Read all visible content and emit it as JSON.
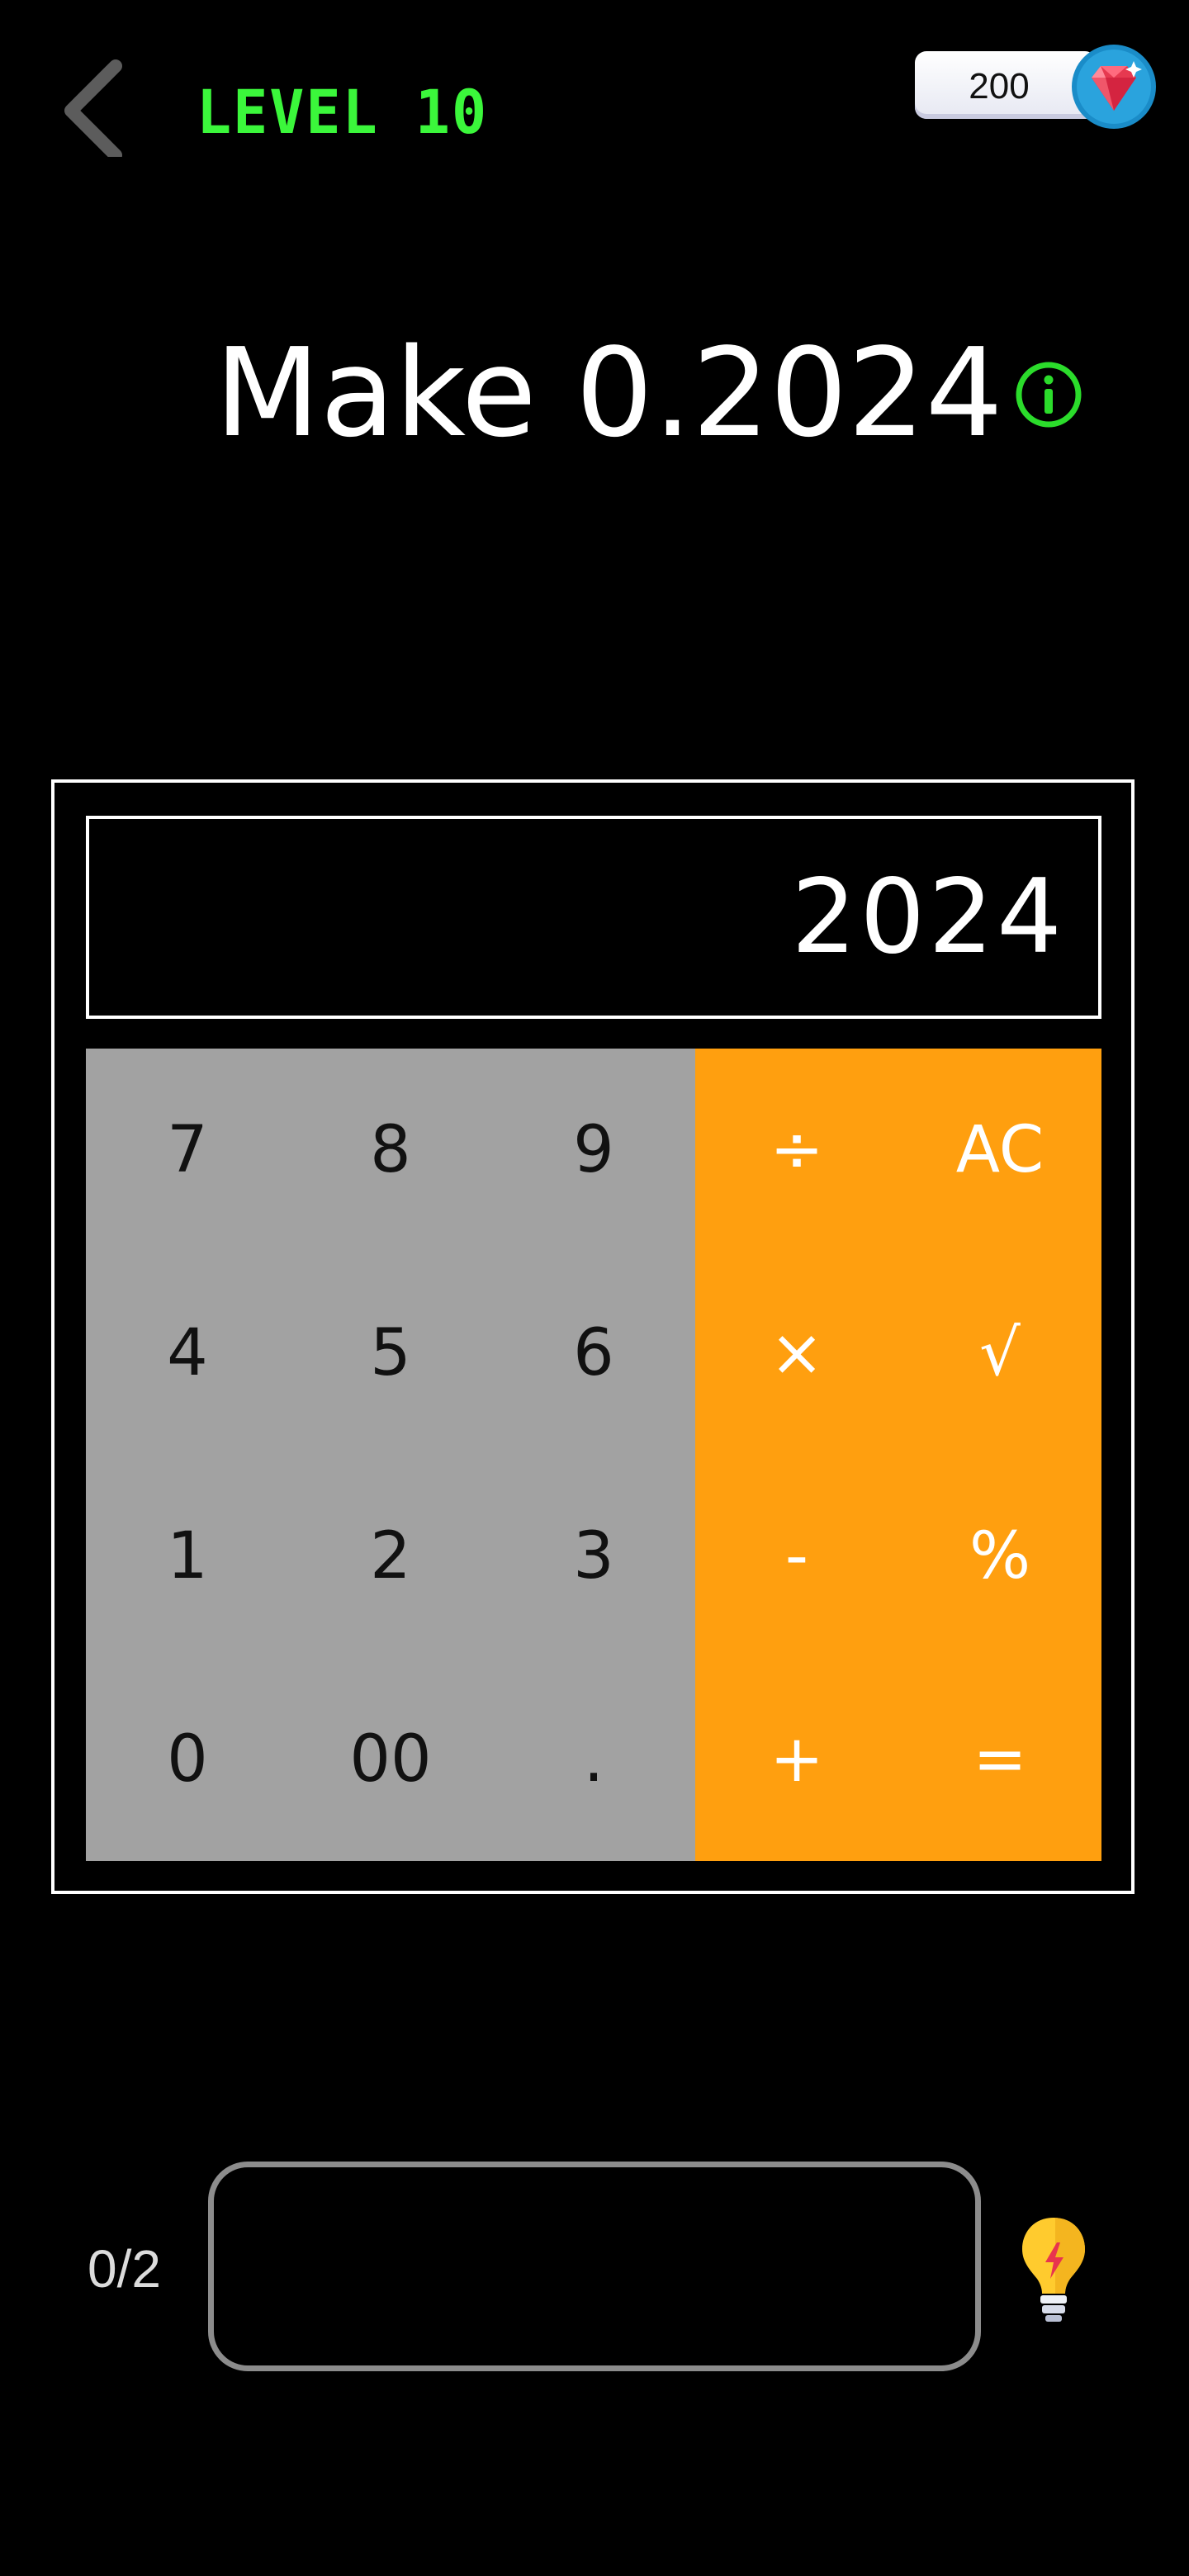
{
  "header": {
    "back_icon": "chevron-left-icon",
    "level_title": "LEVEL 10",
    "gems": "200",
    "gem_icon": "ruby-gem-icon"
  },
  "puzzle": {
    "target": "Make 0.2024",
    "info_icon": "info-icon"
  },
  "calculator": {
    "display": "2024",
    "keys": [
      [
        "7",
        "8",
        "9",
        "÷",
        "AC"
      ],
      [
        "4",
        "5",
        "6",
        "×",
        "√"
      ],
      [
        "1",
        "2",
        "3",
        "-",
        "%"
      ],
      [
        "0",
        "00",
        ".",
        "+",
        "="
      ]
    ]
  },
  "footer": {
    "progress": "0/2",
    "answer_value": "",
    "hint_icon": "lightbulb-icon"
  },
  "colors": {
    "accent_green": "#3bf73b",
    "number_key": "#a2a2a2",
    "operator_key": "#ff9f0f",
    "background": "#000000"
  }
}
